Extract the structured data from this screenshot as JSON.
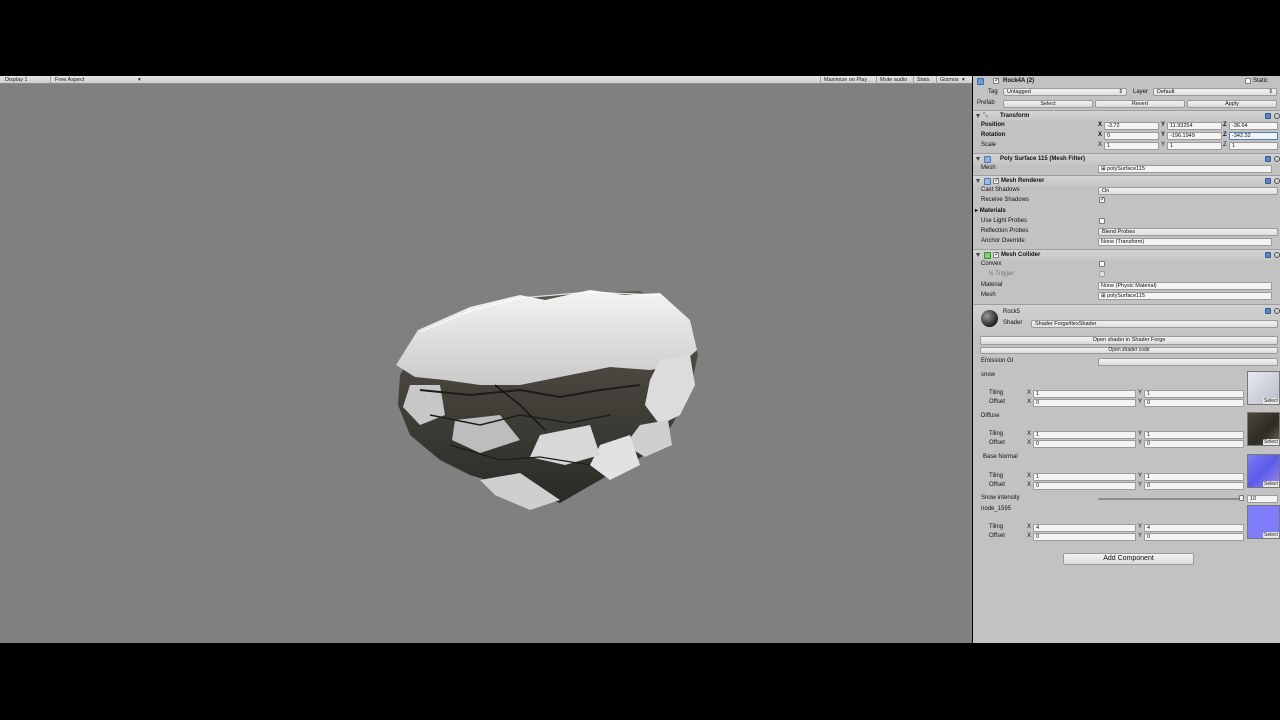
{
  "gameview": {
    "display": "Display 1",
    "aspect": "Free Aspect",
    "maximize": "Maximize on Play",
    "mute": "Mute audio",
    "stats": "Stats",
    "gizmos": "Gizmos"
  },
  "object": {
    "name": "Rock4A (2)",
    "static_label": "Static",
    "tag_label": "Tag",
    "tag_value": "Untagged",
    "layer_label": "Layer",
    "layer_value": "Default",
    "prefab_label": "Prefab",
    "prefab_select": "Select",
    "prefab_revert": "Revert",
    "prefab_apply": "Apply"
  },
  "transform": {
    "title": "Transform",
    "position_label": "Position",
    "rotation_label": "Rotation",
    "scale_label": "Scale",
    "position": {
      "x": "-3.72",
      "y": "11.93254",
      "z": "-36.64"
    },
    "rotation": {
      "x": "0",
      "y": "-196.1949",
      "z": "-342.32"
    },
    "scale": {
      "x": "1",
      "y": "1",
      "z": "1"
    }
  },
  "mesh_filter": {
    "title": "Poly Surface 115 (Mesh Filter)",
    "mesh_label": "Mesh",
    "mesh_value": "polySurface115"
  },
  "mesh_renderer": {
    "title": "Mesh Renderer",
    "cast_shadows_label": "Cast Shadows",
    "cast_shadows_value": "On",
    "receive_shadows_label": "Receive Shadows",
    "materials_label": "Materials",
    "light_probes_label": "Use Light Probes",
    "reflection_probes_label": "Reflection Probes",
    "reflection_probes_value": "Blend Probes",
    "anchor_label": "Anchor Override",
    "anchor_value": "None (Transform)"
  },
  "mesh_collider": {
    "title": "Mesh Collider",
    "convex_label": "Convex",
    "trigger_label": "Is Trigger",
    "material_label": "Material",
    "material_value": "None (Physic Material)",
    "mesh_label": "Mesh",
    "mesh_value": "polySurface115"
  },
  "material": {
    "name": "Rock5",
    "shader_label": "Shader",
    "shader_value": "Shader Forge/itexShader",
    "open_forge": "Open shader in Shader Forge",
    "open_code": "Open shader code",
    "emission_label": "Emission GI",
    "tiling_label": "Tiling",
    "offset_label": "Offset",
    "select_label": "Select",
    "textures": [
      {
        "name": "snow",
        "tiling_x": "1",
        "tiling_y": "1",
        "offset_x": "0",
        "offset_y": "0"
      },
      {
        "name": "Diffuse",
        "tiling_x": "1",
        "tiling_y": "1",
        "offset_x": "0",
        "offset_y": "0"
      },
      {
        "name": "Base Normal",
        "tiling_x": "1",
        "tiling_y": "1",
        "offset_x": "0",
        "offset_y": "0"
      }
    ],
    "snow_intensity_label": "Snow intensity",
    "snow_intensity_value": "10",
    "node_label": "node_1595",
    "node_tiling_x": "4",
    "node_tiling_y": "4",
    "node_offset_x": "0",
    "node_offset_y": "0"
  },
  "add_component": "Add Component",
  "axis": {
    "x": "X",
    "y": "Y",
    "z": "Z"
  },
  "colors": {
    "inspector_bg": "#c2c2c2",
    "viewport_bg": "#808080",
    "header_bg": "#d0d0d0"
  }
}
